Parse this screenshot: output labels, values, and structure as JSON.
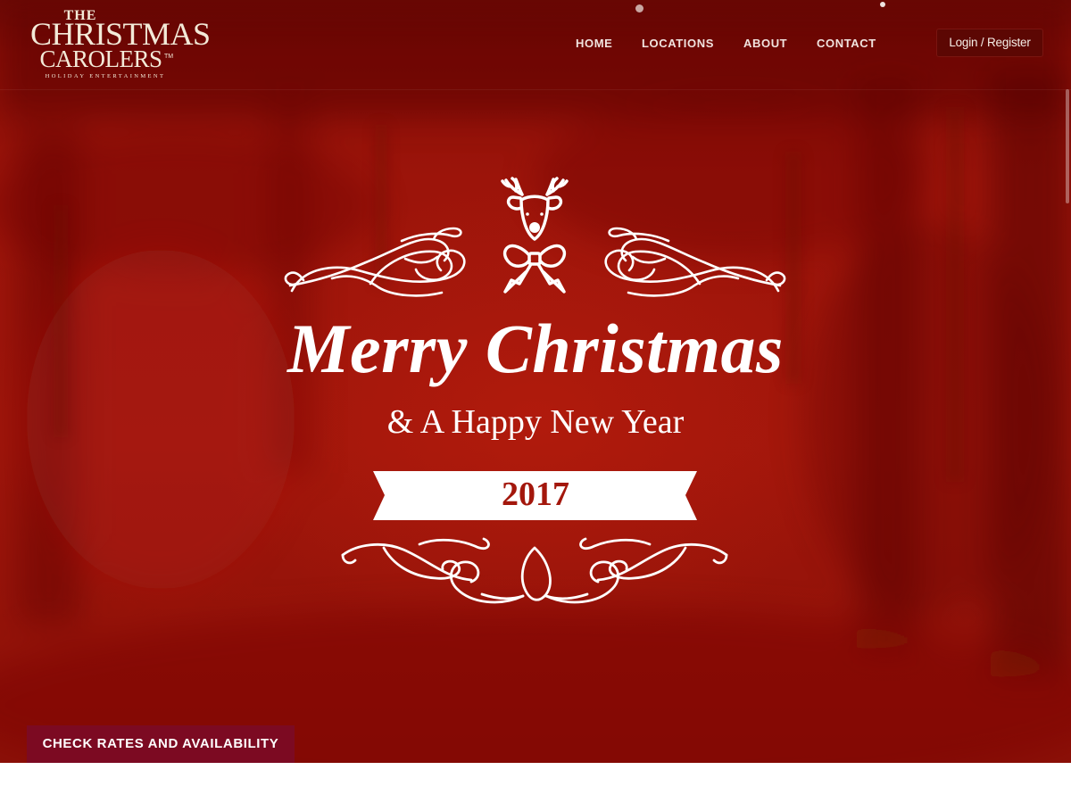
{
  "brand": {
    "logo_the": "THE",
    "logo_christmas": "CHRISTMAS",
    "logo_carolers": "CAROLERS",
    "logo_tm": "TM",
    "logo_subtitle": "HOLIDAY ENTERTAINMENT"
  },
  "nav": {
    "items": [
      {
        "label": "HOME"
      },
      {
        "label": "LOCATIONS"
      },
      {
        "label": "ABOUT"
      },
      {
        "label": "CONTACT"
      }
    ],
    "login_label": "Login / Register"
  },
  "hero": {
    "title": "Merry Christmas",
    "subtitle": "& A Happy New Year",
    "year": "2017",
    "cta_label": "CHECK RATES AND AVAILABILITY"
  },
  "icons": {
    "reindeer": "reindeer-icon",
    "bow": "bow-icon",
    "flourish": "flourish-ornament"
  },
  "colors": {
    "hero_red": "#a0160b",
    "year_red": "#a3170c",
    "cta_burgundy": "#7c0a22",
    "login_bg": "#5c0703",
    "text_light": "#ffffff"
  }
}
